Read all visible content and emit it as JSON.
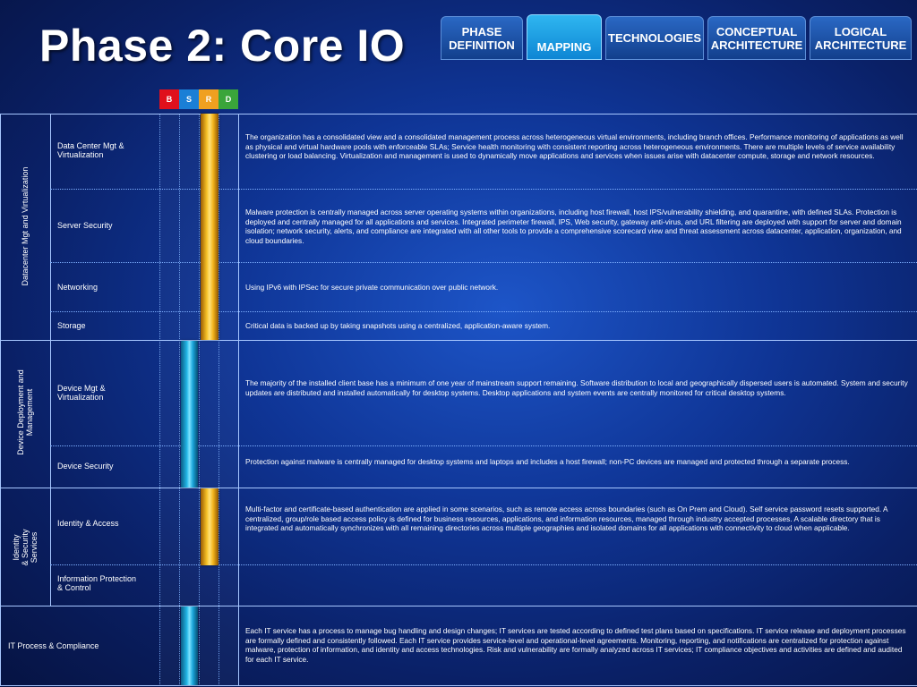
{
  "page": {
    "title": "Phase 2: Core IO"
  },
  "tabs": [
    {
      "label": "PHASE\nDEFINITION",
      "active": false
    },
    {
      "label": "MAPPING",
      "active": true
    },
    {
      "label": "TECHNOLOGIES",
      "active": false
    },
    {
      "label": "CONCEPTUAL\nARCHITECTURE",
      "active": false
    },
    {
      "label": "LOGICAL\nARCHITECTURE",
      "active": false
    }
  ],
  "levels": [
    {
      "label": "B",
      "color": "#e0101c"
    },
    {
      "label": "S",
      "color": "#1a7fd6"
    },
    {
      "label": "R",
      "color": "#f0a020"
    },
    {
      "label": "D",
      "color": "#3aa53a"
    }
  ],
  "colors": {
    "gold": "#f2b41c",
    "cyan": "#22b6e6"
  },
  "categories": [
    {
      "label": "Datacenter Mgt and Virtualization"
    },
    {
      "label": "Device Deployment and\nManagement"
    },
    {
      "label": "Identity\n& Security\nServices"
    },
    {
      "label": "IT Process & Compliance"
    }
  ],
  "rows": [
    {
      "name": "Data Center Mgt &\nVirtualization",
      "level": "R",
      "text": "The organization has a consolidated view and a consolidated management process across heterogeneous virtual environments, including branch offices. Performance monitoring of applications as well as physical and virtual hardware pools with enforceable SLAs; Service health monitoring with consistent reporting across heterogeneous environments. There are multiple levels of service availability clustering or load balancing. Virtualization and management is used to dynamically move applications and services when issues arise with datacenter compute, storage and network resources."
    },
    {
      "name": "Server Security",
      "level": "R",
      "text": "Malware protection is centrally managed across server operating systems within organizations, including host firewall, host IPS/vulnerability shielding, and quarantine, with defined SLAs. Protection is deployed and centrally managed for all applications and services. Integrated perimeter firewall, IPS, Web security, gateway anti-virus, and URL filtering are deployed with support for server and domain isolation; network security, alerts, and compliance are integrated with all other tools to provide a comprehensive scorecard view and threat assessment across datacenter, application, organization, and cloud boundaries."
    },
    {
      "name": "Networking",
      "level": "R",
      "text": "Using IPv6 with IPSec for secure private communication over public network."
    },
    {
      "name": "Storage",
      "level": "R",
      "text": "Critical data is backed up by taking snapshots using a centralized, application-aware system."
    },
    {
      "name": "Device Mgt &\nVirtualization",
      "level": "S",
      "text": "The majority of the installed client base has a minimum of one year of mainstream support remaining. Software distribution to local and geographically dispersed users is automated. System and security updates are distributed and installed automatically for desktop systems. Desktop applications and system events are centrally monitored for critical desktop systems."
    },
    {
      "name": "Device Security",
      "level": "S",
      "text": "Protection against malware is centrally managed for desktop systems and laptops and includes a host firewall; non-PC devices are managed and protected through a separate process."
    },
    {
      "name": "Identity & Access",
      "level": "R",
      "text": "Multi-factor and certificate-based authentication are applied in some scenarios, such as remote access across boundaries (such as On Prem and Cloud). Self service password resets supported. A centralized, group/role based access policy is defined for business resources, applications, and information resources, managed through industry accepted processes. A scalable directory that is integrated and automatically synchronizes with all remaining directories across multiple geographies and isolated domains for all applications with connectivity to cloud when applicable."
    },
    {
      "name": "Information Protection\n& Control",
      "level": "",
      "text": ""
    },
    {
      "name": "",
      "level": "S",
      "text": "Each IT service has a process to manage bug handling and design changes; IT services are tested according to defined test plans based on specifications. IT service release and deployment processes are formally defined and consistently followed. Each IT service provides service-level and operational-level agreements. Monitoring, reporting, and notifications are centralized for protection against malware, protection of information, and identity and access technologies. Risk and vulnerability are formally analyzed across IT services; IT compliance objectives and activities are defined and audited for each IT service."
    }
  ]
}
